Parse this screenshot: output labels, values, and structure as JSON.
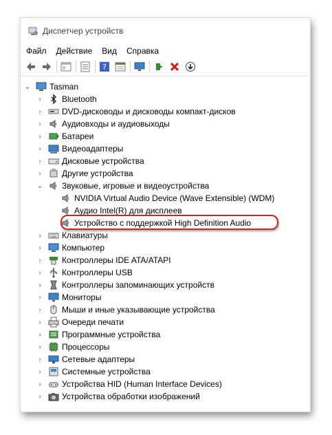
{
  "window": {
    "title": "Диспетчер устройств"
  },
  "menu": [
    "Файл",
    "Действие",
    "Вид",
    "Справка"
  ],
  "toolbar": [
    "back-icon",
    "forward-icon",
    "sep",
    "properties-view-icon",
    "sep",
    "list-icon",
    "sep",
    "help-icon",
    "grid-icon",
    "sep",
    "monitor-icon",
    "sep",
    "update-driver-icon",
    "uninstall-icon",
    "download-icon"
  ],
  "tree": {
    "root": "Tasman",
    "items": [
      {
        "label": "Bluetooth",
        "icon": "bluetooth-icon"
      },
      {
        "label": "DVD-дисководы и дисководы компакт-дисков",
        "icon": "dvd-icon"
      },
      {
        "label": "Аудиовходы и аудиовыходы",
        "icon": "speaker-icon"
      },
      {
        "label": "Батареи",
        "icon": "battery-icon"
      },
      {
        "label": "Видеоадаптеры",
        "icon": "display-adapter-icon"
      },
      {
        "label": "Дисковые устройства",
        "icon": "disk-icon"
      },
      {
        "label": "Другие устройства",
        "icon": "other-device-icon"
      },
      {
        "label": "Звуковые, игровые и видеоустройства",
        "icon": "speaker-icon",
        "expanded": true,
        "children": [
          {
            "label": "NVIDIA Virtual Audio Device (Wave Extensible) (WDM)",
            "icon": "speaker-icon"
          },
          {
            "label": "Аудио Intel(R) для дисплеев",
            "icon": "speaker-icon"
          },
          {
            "label": "Устройство с поддержкой High Definition Audio",
            "icon": "speaker-icon",
            "highlighted": true
          }
        ]
      },
      {
        "label": "Клавиатуры",
        "icon": "keyboard-icon"
      },
      {
        "label": "Компьютер",
        "icon": "computer-icon"
      },
      {
        "label": "Контроллеры IDE ATA/ATAPI",
        "icon": "ide-controller-icon"
      },
      {
        "label": "Контроллеры USB",
        "icon": "usb-icon"
      },
      {
        "label": "Контроллеры запоминающих устройств",
        "icon": "storage-controller-icon"
      },
      {
        "label": "Мониторы",
        "icon": "monitor-icon"
      },
      {
        "label": "Мыши и иные указывающие устройства",
        "icon": "mouse-icon"
      },
      {
        "label": "Очереди печати",
        "icon": "printer-icon"
      },
      {
        "label": "Программные устройства",
        "icon": "software-device-icon"
      },
      {
        "label": "Процессоры",
        "icon": "processor-icon"
      },
      {
        "label": "Сетевые адаптеры",
        "icon": "network-icon"
      },
      {
        "label": "Системные устройства",
        "icon": "system-device-icon"
      },
      {
        "label": "Устройства HID (Human Interface Devices)",
        "icon": "hid-icon"
      },
      {
        "label": "Устройства обработки изображений",
        "icon": "camera-icon"
      }
    ]
  }
}
